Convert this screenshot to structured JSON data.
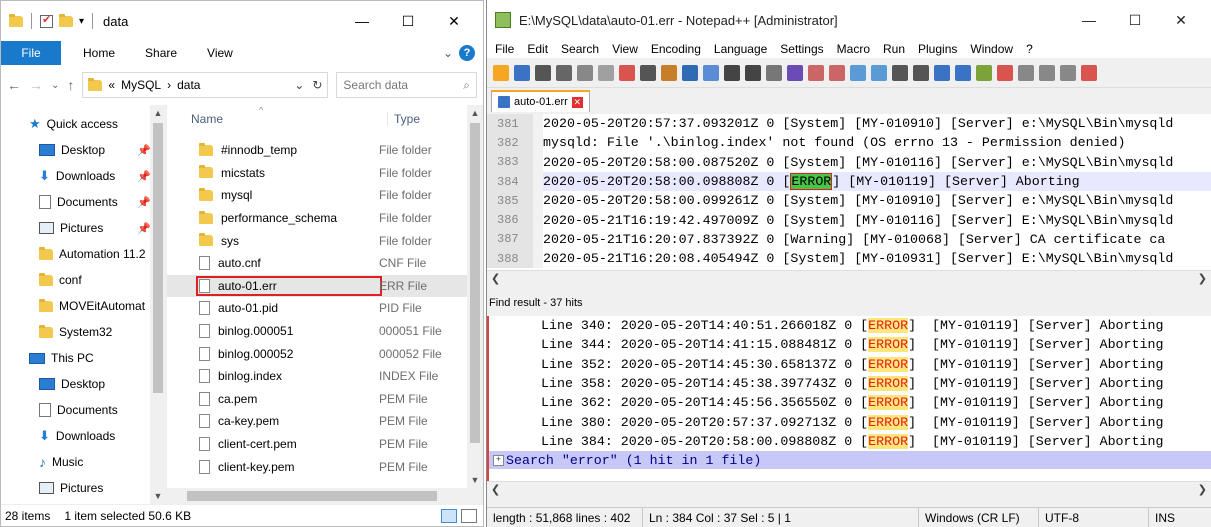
{
  "explorer": {
    "title": "data",
    "window_controls": [
      "—",
      "☐",
      "✕"
    ],
    "ribbon": {
      "file": "File",
      "tabs": [
        "Home",
        "Share",
        "View"
      ],
      "help": "?"
    },
    "address": {
      "prefix": "«",
      "segments": [
        "MySQL",
        "data"
      ],
      "search_placeholder": "Search data"
    },
    "nav": [
      {
        "label": "Quick access",
        "icon": "star-icon",
        "root": true
      },
      {
        "label": "Desktop",
        "icon": "desktop-icon",
        "pinned": true
      },
      {
        "label": "Downloads",
        "icon": "download-icon",
        "pinned": true
      },
      {
        "label": "Documents",
        "icon": "document-icon",
        "pinned": true
      },
      {
        "label": "Pictures",
        "icon": "pictures-icon",
        "pinned": true
      },
      {
        "label": "Automation 11.2",
        "icon": "folder-icon"
      },
      {
        "label": "conf",
        "icon": "folder-icon"
      },
      {
        "label": "MOVEitAutomat",
        "icon": "folder-icon"
      },
      {
        "label": "System32",
        "icon": "folder-icon"
      },
      {
        "label": "This PC",
        "icon": "computer-icon",
        "root": true
      },
      {
        "label": "Desktop",
        "icon": "desktop-icon"
      },
      {
        "label": "Documents",
        "icon": "document-icon"
      },
      {
        "label": "Downloads",
        "icon": "download-icon"
      },
      {
        "label": "Music",
        "icon": "music-icon"
      },
      {
        "label": "Pictures",
        "icon": "pictures-icon"
      }
    ],
    "columns": {
      "name": "Name",
      "type": "Type"
    },
    "files": [
      {
        "name": "#innodb_temp",
        "type": "File folder",
        "kind": "folder"
      },
      {
        "name": "micstats",
        "type": "File folder",
        "kind": "folder"
      },
      {
        "name": "mysql",
        "type": "File folder",
        "kind": "folder"
      },
      {
        "name": "performance_schema",
        "type": "File folder",
        "kind": "folder"
      },
      {
        "name": "sys",
        "type": "File folder",
        "kind": "folder"
      },
      {
        "name": "auto.cnf",
        "type": "CNF File",
        "kind": "file"
      },
      {
        "name": "auto-01.err",
        "type": "ERR File",
        "kind": "file",
        "selected": true
      },
      {
        "name": "auto-01.pid",
        "type": "PID File",
        "kind": "file"
      },
      {
        "name": "binlog.000051",
        "type": "000051 File",
        "kind": "file"
      },
      {
        "name": "binlog.000052",
        "type": "000052 File",
        "kind": "file"
      },
      {
        "name": "binlog.index",
        "type": "INDEX File",
        "kind": "file"
      },
      {
        "name": "ca.pem",
        "type": "PEM File",
        "kind": "file"
      },
      {
        "name": "ca-key.pem",
        "type": "PEM File",
        "kind": "file"
      },
      {
        "name": "client-cert.pem",
        "type": "PEM File",
        "kind": "file"
      },
      {
        "name": "client-key.pem",
        "type": "PEM File",
        "kind": "file"
      }
    ],
    "status": {
      "count": "28 items",
      "selection": "1 item selected  50.6 KB"
    }
  },
  "npp": {
    "title": "E:\\MySQL\\data\\auto-01.err - Notepad++ [Administrator]",
    "window_controls": [
      "—",
      "☐",
      "✕"
    ],
    "menu": [
      "File",
      "Edit",
      "Search",
      "View",
      "Encoding",
      "Language",
      "Settings",
      "Macro",
      "Run",
      "Plugins",
      "Window",
      "?"
    ],
    "tab": "auto-01.err",
    "lines": [
      {
        "n": "381",
        "text": "2020-05-20T20:57:37.093201Z 0 [System] [MY-010910] [Server] e:\\MySQL\\Bin\\mysqld"
      },
      {
        "n": "382",
        "text": "mysqld: File '.\\binlog.index' not found (OS errno 13 - Permission denied)"
      },
      {
        "n": "383",
        "text": "2020-05-20T20:58:00.087520Z 0 [System] [MY-010116] [Server] e:\\MySQL\\Bin\\mysqld"
      },
      {
        "n": "384",
        "pre": "2020-05-20T20:58:00.098808Z 0 [",
        "hl": "ERROR",
        "post": "] [MY-010119] [Server] Aborting",
        "current": true
      },
      {
        "n": "385",
        "text": "2020-05-20T20:58:00.099261Z 0 [System] [MY-010910] [Server] e:\\MySQL\\Bin\\mysqld"
      },
      {
        "n": "386",
        "text": "2020-05-21T16:19:42.497009Z 0 [System] [MY-010116] [Server] E:\\MySQL\\Bin\\mysqld"
      },
      {
        "n": "387",
        "text": "2020-05-21T16:20:07.837392Z 0 [Warning] [MY-010068] [Server] CA certificate ca"
      },
      {
        "n": "388",
        "text": "2020-05-21T16:20:08.405494Z 0 [System] [MY-010931] [Server] E:\\MySQL\\Bin\\mysqld"
      }
    ],
    "find_title": "Find result - 37 hits",
    "results": [
      {
        "pre": "Line 340: 2020-05-20T14:40:51.266018Z 0 [",
        "hl": "ERROR",
        "post": "]  [MY-010119] [Server] Aborting"
      },
      {
        "pre": "Line 344: 2020-05-20T14:41:15.088481Z 0 [",
        "hl": "ERROR",
        "post": "]  [MY-010119] [Server] Aborting"
      },
      {
        "pre": "Line 352: 2020-05-20T14:45:30.658137Z 0 [",
        "hl": "ERROR",
        "post": "]  [MY-010119] [Server] Aborting"
      },
      {
        "pre": "Line 358: 2020-05-20T14:45:38.397743Z 0 [",
        "hl": "ERROR",
        "post": "]  [MY-010119] [Server] Aborting"
      },
      {
        "pre": "Line 362: 2020-05-20T14:45:56.356550Z 0 [",
        "hl": "ERROR",
        "post": "]  [MY-010119] [Server] Aborting"
      },
      {
        "pre": "Line 380: 2020-05-20T20:57:37.092713Z 0 [",
        "hl": "ERROR",
        "post": "]  [MY-010119] [Server] Aborting"
      },
      {
        "pre": "Line 384: 2020-05-20T20:58:00.098808Z 0 [",
        "hl": "ERROR",
        "post": "]  [MY-010119] [Server] Aborting"
      }
    ],
    "search_summary": "Search \"error\" (1 hit in 1 file)",
    "status": [
      "length : 51,868    lines : 402",
      "Ln : 384    Col : 37    Sel : 5 | 1",
      "Windows (CR LF)",
      "UTF-8",
      "INS"
    ]
  }
}
